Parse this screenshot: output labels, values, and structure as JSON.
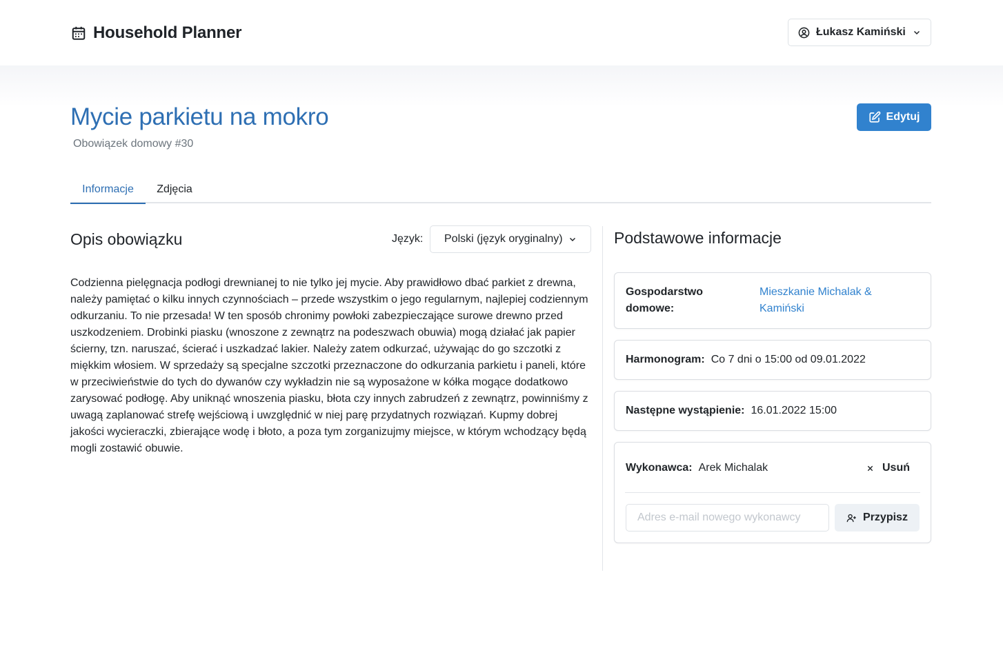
{
  "header": {
    "app_name": "Household Planner",
    "user_name": "Łukasz Kamiński"
  },
  "page": {
    "title": "Mycie parkietu na mokro",
    "subtitle": "Obowiązek domowy #30",
    "edit_label": "Edytuj"
  },
  "tabs": [
    {
      "label": "Informacje",
      "active": true
    },
    {
      "label": "Zdjęcia",
      "active": false
    }
  ],
  "description_section": {
    "title": "Opis obowiązku",
    "language_label": "Język:",
    "language_value": "Polski (język oryginalny)",
    "text": "Codzienna pielęgnacja podłogi drewnianej to nie tylko jej mycie. Aby prawidłowo dbać parkiet z drewna, należy pamiętać o kilku innych czynnościach – przede wszystkim o jego regularnym, najlepiej codziennym odkurzaniu. To nie przesada! W ten sposób chronimy powłoki zabezpieczające surowe drewno przed uszkodzeniem. Drobinki piasku (wnoszone z zewnątrz na podeszwach obuwia) mogą działać jak papier ścierny, tzn. naruszać, ścierać i uszkadzać lakier. Należy zatem odkurzać, używając do go szczotki z miękkim włosiem. W sprzedaży są specjalne szczotki przeznaczone do odkurzania parkietu i paneli, które w przeciwieństwie do tych do dywanów czy wykładzin nie są wyposażone w kółka mogące dodatkowo zarysować podłogę. Aby uniknąć wnoszenia piasku, błota czy innych zabrudzeń z zewnątrz, powinniśmy z uwagą zaplanować strefę wejściową i uwzględnić w niej parę przydatnych rozwiązań. Kupmy dobrej jakości wycieraczki, zbierające wodę i błoto, a poza tym zorganizujmy miejsce, w którym wchodzący będą mogli zostawić obuwie."
  },
  "info_section": {
    "title": "Podstawowe informacje",
    "household_label": "Gospodarstwo domowe:",
    "household_value": "Mieszkanie Michalak & Kamiński",
    "schedule_label": "Harmonogram:",
    "schedule_value": "Co 7 dni o 15:00 od 09.01.2022",
    "next_label": "Następne wystąpienie:",
    "next_value": "16.01.2022 15:00",
    "assignee_label": "Wykonawca:",
    "assignee_value": "Arek Michalak",
    "remove_label": "Usuń",
    "email_placeholder": "Adres e-mail nowego wykonawcy",
    "assign_label": "Przypisz"
  },
  "icons": {
    "brand": "calendar-icon",
    "user": "user-circle-icon",
    "edit": "edit-icon",
    "assign": "user-plus-icon",
    "remove": "close-icon"
  },
  "colors": {
    "accent": "#3182ce",
    "title": "#2e6fb3",
    "muted": "#6c757d"
  }
}
